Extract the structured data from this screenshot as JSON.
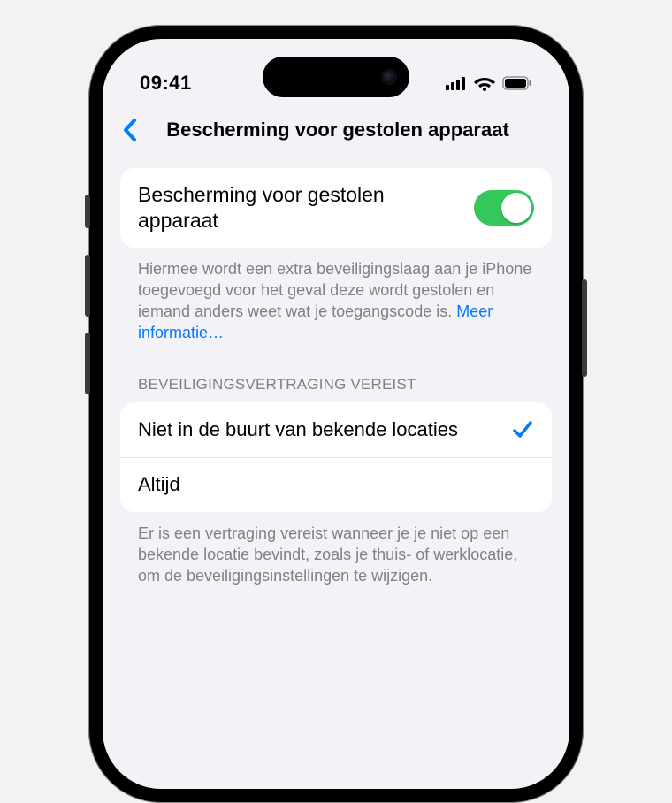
{
  "status": {
    "time": "09:41"
  },
  "nav": {
    "title": "Bescherming voor gestolen apparaat"
  },
  "toggle": {
    "label": "Bescherming voor gestolen apparaat",
    "on": true
  },
  "toggleFooter": {
    "text": "Hiermee wordt een extra beveiligingslaag aan je iPhone toegevoegd voor het geval deze wordt gestolen en iemand anders weet wat je toegangscode is. ",
    "link": "Meer informatie…"
  },
  "delaySection": {
    "header": "BEVEILIGINGSVERTRAGING VEREIST",
    "options": [
      {
        "label": "Niet in de buurt van bekende locaties",
        "selected": true
      },
      {
        "label": "Altijd",
        "selected": false
      }
    ],
    "footer": "Er is een vertraging vereist wanneer je je niet op een bekende locatie bevindt, zoals je thuis- of werklocatie, om de beveiligingsinstellingen te wijzigen."
  },
  "colors": {
    "accent": "#007aff",
    "switchOn": "#34c759"
  }
}
